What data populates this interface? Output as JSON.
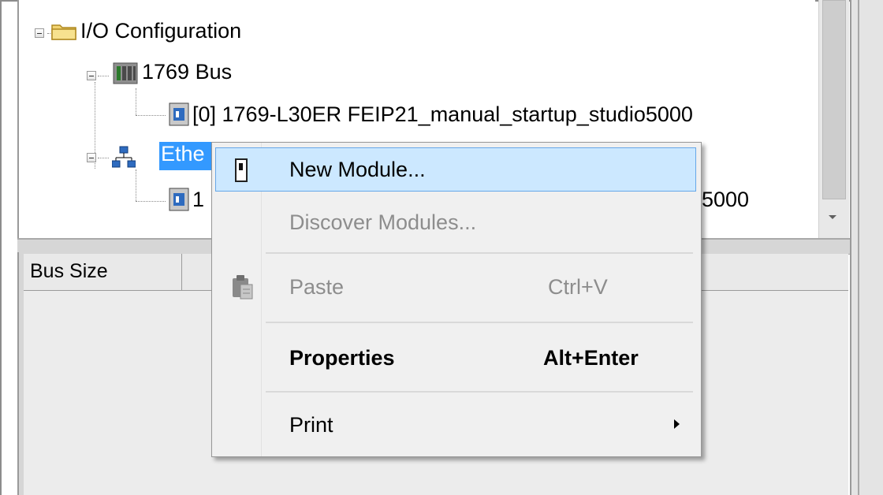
{
  "tree": {
    "io_config": "I/O Configuration",
    "bus_1769": "1769 Bus",
    "controller": "[0] 1769-L30ER FEIP21_manual_startup_studio5000",
    "ethernet": "Ethe",
    "ethernet_child_prefix": "1",
    "ethernet_child_suffix": "5000"
  },
  "grid": {
    "column_bus_size": "Bus Size"
  },
  "context_menu": {
    "items": [
      {
        "label": "New Module...",
        "shortcut": "",
        "state": "highlighted",
        "icon": "new-module-icon"
      },
      {
        "label": "Discover Modules...",
        "shortcut": "",
        "state": "disabled",
        "icon": ""
      },
      {
        "label": "Paste",
        "shortcut": "Ctrl+V",
        "state": "disabled",
        "icon": "paste-icon"
      },
      {
        "label": "Properties",
        "shortcut": "Alt+Enter",
        "state": "default-bold",
        "icon": ""
      },
      {
        "label": "Print",
        "shortcut": "",
        "state": "submenu",
        "icon": ""
      }
    ]
  },
  "colors": {
    "selection": "#3399ff",
    "menu_highlight": "#cce8ff",
    "menu_background": "#f0f0f0"
  }
}
